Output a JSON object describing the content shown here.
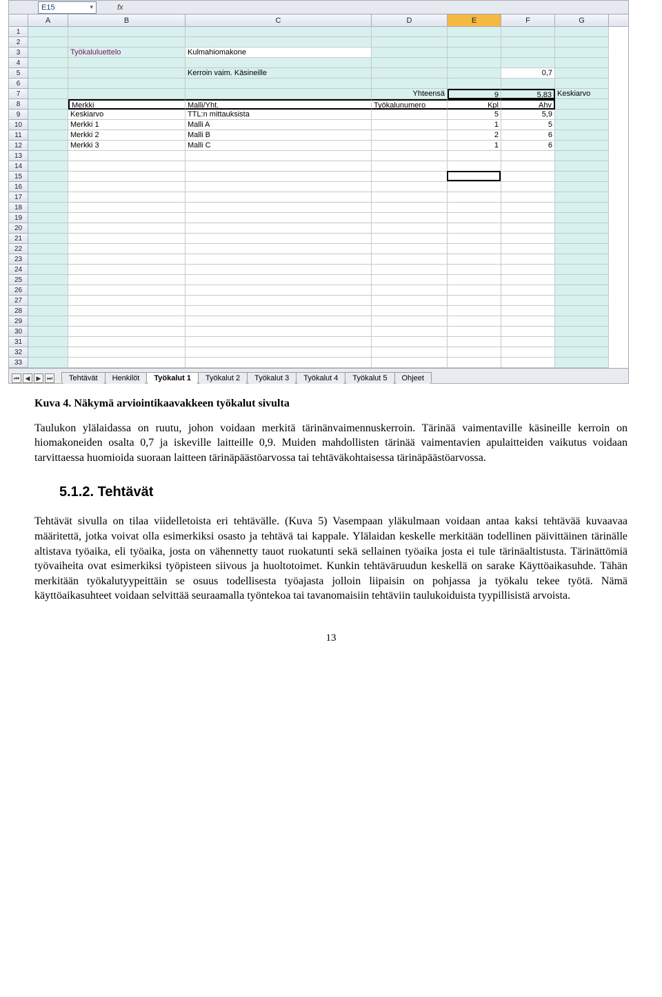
{
  "spreadsheet": {
    "namebox": "E15",
    "fx_label": "fx",
    "columns": [
      "A",
      "B",
      "C",
      "D",
      "E",
      "F",
      "G"
    ],
    "selected_col": "E",
    "row_count": 33,
    "selection": {
      "row": 15,
      "col": "E"
    },
    "cells": {
      "r3": {
        "B": "Työkaluluettelo",
        "C": "Kulmahiomakone"
      },
      "r5": {
        "C": "Kerroin vaim. Käsineille",
        "F": "0,7"
      },
      "r7": {
        "D": "Yhteensä",
        "E": "9",
        "F": "5,83",
        "G": "Keskiarvo"
      },
      "r8": {
        "B": "Merkki",
        "C": "Malli/Yht.",
        "D": "Työkalunumero",
        "E": "Kpl",
        "F": "Ahv"
      },
      "r9": {
        "B": "Keskiarvo",
        "C": "TTL:n mittauksista",
        "E": "5",
        "F": "5,9"
      },
      "r10": {
        "B": "Merkki 1",
        "C": "Malli A",
        "E": "1",
        "F": "5"
      },
      "r11": {
        "B": "Merkki 2",
        "C": "Malli B",
        "E": "2",
        "F": "6"
      },
      "r12": {
        "B": "Merkki 3",
        "C": "Malli C",
        "E": "1",
        "F": "6"
      }
    },
    "tabs": [
      "Tehtävät",
      "Henkilöt",
      "Työkalut 1",
      "Työkalut 2",
      "Työkalut 3",
      "Työkalut 4",
      "Työkalut 5",
      "Ohjeet"
    ],
    "active_tab": 2,
    "nav_icons": [
      "⏮",
      "◀",
      "▶",
      "⏭"
    ]
  },
  "document": {
    "caption": "Kuva 4. Näkymä arviointikaavakkeen työkalut sivulta",
    "para1": "Taulukon ylälaidassa on ruutu, johon voidaan merkitä tärinänvaimennuskerroin. Tärinää vaimentaville käsineille kerroin on hiomakoneiden osalta 0,7 ja iskeville laitteille 0,9. Muiden mahdollisten tärinää vaimentavien apulaitteiden vaikutus voidaan tarvittaessa huomioida suoraan laitteen tärinäpäästöarvossa tai tehtäväkohtaisessa tärinäpäästöarvossa.",
    "heading": "5.1.2. Tehtävät",
    "para2": "Tehtävät sivulla on tilaa viidelletoista eri tehtävälle. (Kuva 5) Vasempaan yläkulmaan voidaan antaa kaksi tehtävää kuvaavaa määritettä, jotka voivat olla esimerkiksi osasto ja tehtävä tai kappale. Ylälaidan keskelle merkitään todellinen päivittäinen tärinälle altistava työaika, eli työaika, josta on vähennetty tauot ruokatunti sekä sellainen työaika josta ei tule tärinäaltistusta. Tärinättömiä työvaiheita ovat esimerkiksi työpisteen siivous ja huoltotoimet. Kunkin tehtäväruudun keskellä on sarake Käyttöaikasuhde. Tähän merkitään työkalutyypeittäin se osuus todellisesta työajasta jolloin liipaisin on pohjassa ja työkalu tekee työtä. Nämä käyttöaikasuhteet voidaan selvittää seuraamalla työntekoa tai tavanomaisiin tehtäviin taulukoiduista tyypillisistä arvoista.",
    "pagenum": "13"
  }
}
